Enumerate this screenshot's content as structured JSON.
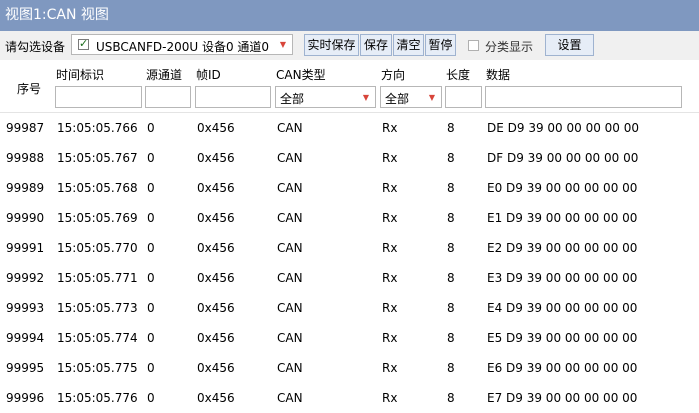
{
  "window": {
    "title": "视图1:CAN 视图"
  },
  "toolbar": {
    "select_label": "请勾选设备",
    "device": {
      "checked": true,
      "text": "USBCANFD-200U 设备0 通道0"
    },
    "buttons": {
      "realtime_save": "实时保存",
      "save": "保存",
      "clear": "清空",
      "pause": "暂停"
    },
    "classify": {
      "checked": false,
      "label": "分类显示"
    },
    "settings": "设置"
  },
  "table": {
    "columns": {
      "index": "序号",
      "timestamp": "时间标识",
      "source_channel": "源通道",
      "frame_id": "帧ID",
      "can_type": "CAN类型",
      "direction": "方向",
      "length": "长度",
      "data": "数据"
    },
    "filters": {
      "can_type": "全部",
      "direction": "全部"
    },
    "rows": [
      {
        "index": "99987",
        "timestamp": "15:05:05.766",
        "source_channel": "0",
        "frame_id": "0x456",
        "can_type": "CAN",
        "direction": "Rx",
        "length": "8",
        "data": "DE D9 39 00 00 00 00 00"
      },
      {
        "index": "99988",
        "timestamp": "15:05:05.767",
        "source_channel": "0",
        "frame_id": "0x456",
        "can_type": "CAN",
        "direction": "Rx",
        "length": "8",
        "data": "DF D9 39 00 00 00 00 00"
      },
      {
        "index": "99989",
        "timestamp": "15:05:05.768",
        "source_channel": "0",
        "frame_id": "0x456",
        "can_type": "CAN",
        "direction": "Rx",
        "length": "8",
        "data": "E0 D9 39 00 00 00 00 00"
      },
      {
        "index": "99990",
        "timestamp": "15:05:05.769",
        "source_channel": "0",
        "frame_id": "0x456",
        "can_type": "CAN",
        "direction": "Rx",
        "length": "8",
        "data": "E1 D9 39 00 00 00 00 00"
      },
      {
        "index": "99991",
        "timestamp": "15:05:05.770",
        "source_channel": "0",
        "frame_id": "0x456",
        "can_type": "CAN",
        "direction": "Rx",
        "length": "8",
        "data": "E2 D9 39 00 00 00 00 00"
      },
      {
        "index": "99992",
        "timestamp": "15:05:05.771",
        "source_channel": "0",
        "frame_id": "0x456",
        "can_type": "CAN",
        "direction": "Rx",
        "length": "8",
        "data": "E3 D9 39 00 00 00 00 00"
      },
      {
        "index": "99993",
        "timestamp": "15:05:05.773",
        "source_channel": "0",
        "frame_id": "0x456",
        "can_type": "CAN",
        "direction": "Rx",
        "length": "8",
        "data": "E4 D9 39 00 00 00 00 00"
      },
      {
        "index": "99994",
        "timestamp": "15:05:05.774",
        "source_channel": "0",
        "frame_id": "0x456",
        "can_type": "CAN",
        "direction": "Rx",
        "length": "8",
        "data": "E5 D9 39 00 00 00 00 00"
      },
      {
        "index": "99995",
        "timestamp": "15:05:05.775",
        "source_channel": "0",
        "frame_id": "0x456",
        "can_type": "CAN",
        "direction": "Rx",
        "length": "8",
        "data": "E6 D9 39 00 00 00 00 00"
      },
      {
        "index": "99996",
        "timestamp": "15:05:05.776",
        "source_channel": "0",
        "frame_id": "0x456",
        "can_type": "CAN",
        "direction": "Rx",
        "length": "8",
        "data": "E7 D9 39 00 00 00 00 00"
      }
    ]
  },
  "colors": {
    "titlebar": "#7f98c0",
    "toolbar": "#f0f0f0",
    "button": "#e6edf7",
    "dropdown_arrow": "#d8453a"
  }
}
